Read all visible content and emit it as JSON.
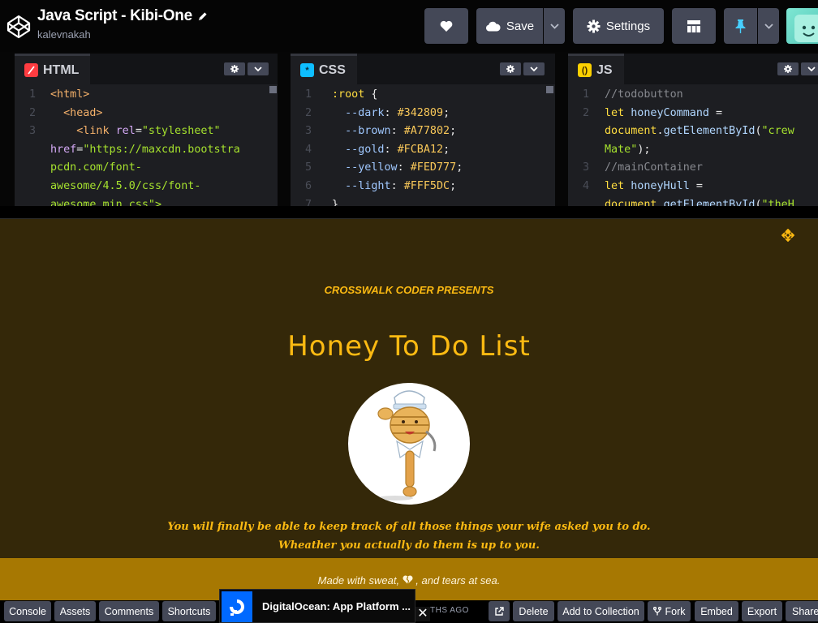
{
  "header": {
    "title": "Java Script - Kibi-One",
    "author": "kalevnakah",
    "save_label": "Save",
    "settings_label": "Settings"
  },
  "editors": {
    "html": {
      "tab_label": "HTML",
      "icon_color": "#ff3c41",
      "line_numbers": [
        "1",
        "2",
        "3",
        "",
        "",
        "",
        ""
      ],
      "lines": [
        [
          {
            "t": "<html>",
            "c": "c-tag"
          }
        ],
        [
          {
            "t": "  <head>",
            "c": "c-tag"
          }
        ],
        [
          {
            "t": "    <link ",
            "c": "c-tag"
          },
          {
            "t": "rel",
            "c": "c-attr"
          },
          {
            "t": "=",
            "c": "c-plain"
          },
          {
            "t": "\"stylesheet\"",
            "c": "c-str"
          }
        ],
        [
          {
            "t": "href",
            "c": "c-attr"
          },
          {
            "t": "=",
            "c": "c-plain"
          },
          {
            "t": "\"https://maxcdn.bootstra",
            "c": "c-str"
          }
        ],
        [
          {
            "t": "pcdn.com/font-",
            "c": "c-str"
          }
        ],
        [
          {
            "t": "awesome/4.5.0/css/font-",
            "c": "c-str"
          }
        ],
        [
          {
            "t": "awesome.min.css\">",
            "c": "c-str"
          }
        ]
      ]
    },
    "css": {
      "tab_label": "CSS",
      "icon_color": "#0ebeff",
      "line_numbers": [
        "1",
        "2",
        "3",
        "4",
        "5",
        "6",
        "7"
      ],
      "lines": [
        [
          {
            "t": ":root ",
            "c": "c-sel"
          },
          {
            "t": "{",
            "c": "c-plain"
          }
        ],
        [
          {
            "t": "  --dark",
            "c": "c-prop"
          },
          {
            "t": ": ",
            "c": "c-plain"
          },
          {
            "t": "#342809",
            "c": "c-val"
          },
          {
            "t": ";",
            "c": "c-plain"
          }
        ],
        [
          {
            "t": "  --brown",
            "c": "c-prop"
          },
          {
            "t": ": ",
            "c": "c-plain"
          },
          {
            "t": "#A77802",
            "c": "c-val"
          },
          {
            "t": ";",
            "c": "c-plain"
          }
        ],
        [
          {
            "t": "  --gold",
            "c": "c-prop"
          },
          {
            "t": ": ",
            "c": "c-plain"
          },
          {
            "t": "#FCBA12",
            "c": "c-val"
          },
          {
            "t": ";",
            "c": "c-plain"
          }
        ],
        [
          {
            "t": "  --yellow",
            "c": "c-prop"
          },
          {
            "t": ": ",
            "c": "c-plain"
          },
          {
            "t": "#FED777",
            "c": "c-val"
          },
          {
            "t": ";",
            "c": "c-plain"
          }
        ],
        [
          {
            "t": "  --light",
            "c": "c-prop"
          },
          {
            "t": ": ",
            "c": "c-plain"
          },
          {
            "t": "#FFF5DC",
            "c": "c-val"
          },
          {
            "t": ";",
            "c": "c-plain"
          }
        ],
        [
          {
            "t": "}",
            "c": "c-plain"
          }
        ]
      ]
    },
    "js": {
      "tab_label": "JS",
      "icon_color": "#fcd000",
      "line_numbers": [
        "1",
        "2",
        "",
        "",
        "3",
        "4",
        ""
      ],
      "lines": [
        [
          {
            "t": "//todobutton",
            "c": "c-com"
          }
        ],
        [
          {
            "t": "let ",
            "c": "c-kw"
          },
          {
            "t": "honeyCommand",
            "c": "c-var"
          },
          {
            "t": " =",
            "c": "c-plain"
          }
        ],
        [
          {
            "t": "document",
            "c": "c-kw"
          },
          {
            "t": ".",
            "c": "c-plain"
          },
          {
            "t": "getElementById",
            "c": "c-var"
          },
          {
            "t": "(",
            "c": "c-plain"
          },
          {
            "t": "\"crew",
            "c": "c-strjs"
          }
        ],
        [
          {
            "t": "Mate\"",
            "c": "c-strjs"
          },
          {
            "t": ");",
            "c": "c-plain"
          }
        ],
        [
          {
            "t": "//mainContainer",
            "c": "c-com"
          }
        ],
        [
          {
            "t": "let ",
            "c": "c-kw"
          },
          {
            "t": "honeyHull",
            "c": "c-var"
          },
          {
            "t": " =",
            "c": "c-plain"
          }
        ],
        [
          {
            "t": "document",
            "c": "c-kw"
          },
          {
            "t": ".",
            "c": "c-plain"
          },
          {
            "t": "getElementById",
            "c": "c-var"
          },
          {
            "t": "(",
            "c": "c-plain"
          },
          {
            "t": "\"theH",
            "c": "c-strjs"
          }
        ]
      ]
    }
  },
  "preview": {
    "presents": "CROSSWALK CODER PRESENTS",
    "title": "Honey To Do List",
    "tagline_1": "You will finally be able to keep track of all those things your wife asked you to do.",
    "tagline_2": "Wheather you actually do them is up to you.",
    "footer_before": "Made with sweat, ",
    "footer_after": " , and tears at sea.",
    "colors": {
      "dark": "#342809",
      "brown": "#A77802",
      "gold": "#FCBA12",
      "light": "#FFF5DC"
    }
  },
  "bottombar": {
    "console": "Console",
    "assets": "Assets",
    "comments": "Comments",
    "shortcuts": "Shortcuts",
    "ago_text": "THS AGO",
    "delete": "Delete",
    "add_collection": "Add to Collection",
    "fork": "Fork",
    "embed": "Embed",
    "export": "Export",
    "share": "Share"
  },
  "ad": {
    "text": "DigitalOcean: App Platform ...",
    "close": "✕"
  }
}
